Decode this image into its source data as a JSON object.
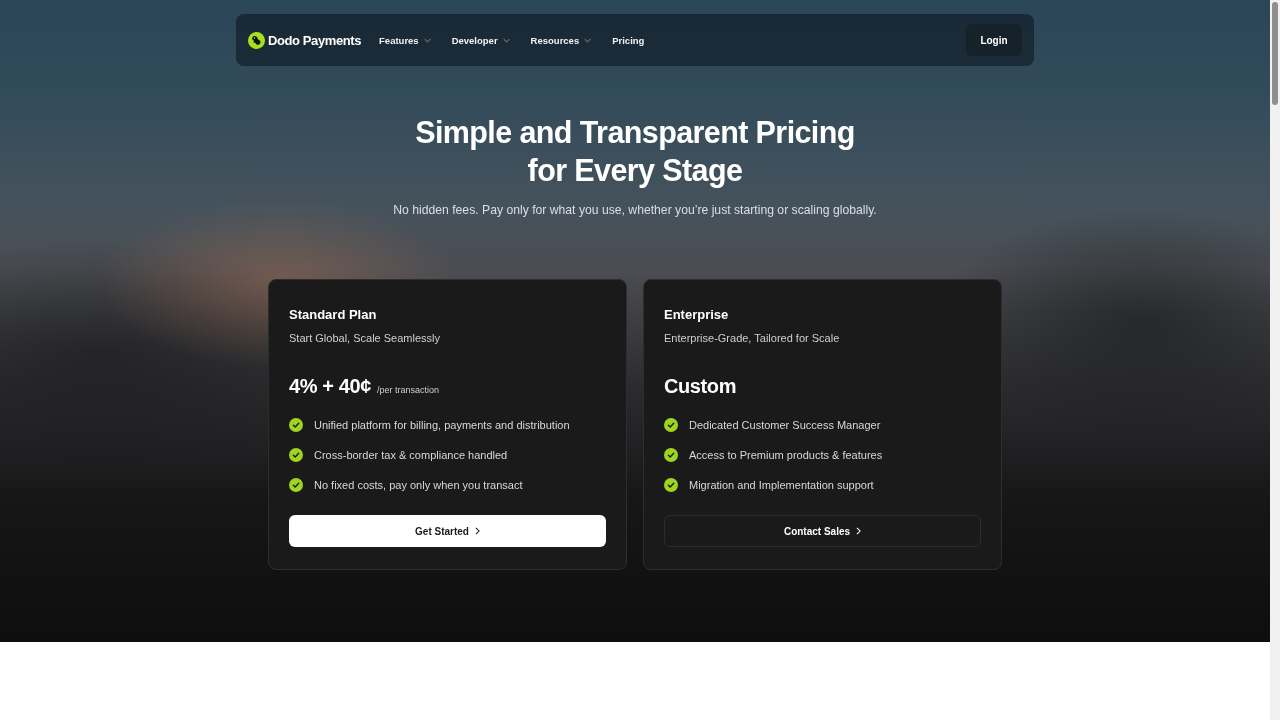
{
  "nav": {
    "logo": "Dodo Payments",
    "items": [
      {
        "label": "Features",
        "dropdown": true
      },
      {
        "label": "Developer",
        "dropdown": true
      },
      {
        "label": "Resources",
        "dropdown": true
      },
      {
        "label": "Pricing",
        "dropdown": false
      }
    ],
    "login": "Login"
  },
  "hero": {
    "title_lines": [
      "Simple and Transparent Pricing",
      "for Every Stage"
    ],
    "subtitle": "No hidden fees. Pay only for what you use, whether you’re just starting or scaling globally."
  },
  "plans": [
    {
      "name": "Standard Plan",
      "tagline": "Start Global, Scale Seamlessly",
      "price": "4% + 40¢",
      "price_unit": "/per transaction",
      "features": [
        "Unified platform for billing, payments and distribution",
        "Cross-border tax & compliance handled",
        "No fixed costs, pay only when you transact"
      ],
      "button": {
        "label": "Get Started",
        "kind": "primary"
      }
    },
    {
      "name": "Enterprise",
      "tagline": "Enterprise-Grade, Tailored for Scale",
      "price": "Custom",
      "features": [
        "Dedicated Customer Success Manager",
        "Access to Premium products & features",
        "Migration and Implementation support"
      ],
      "button": {
        "label": "Contact Sales",
        "kind": "outline"
      }
    }
  ]
}
